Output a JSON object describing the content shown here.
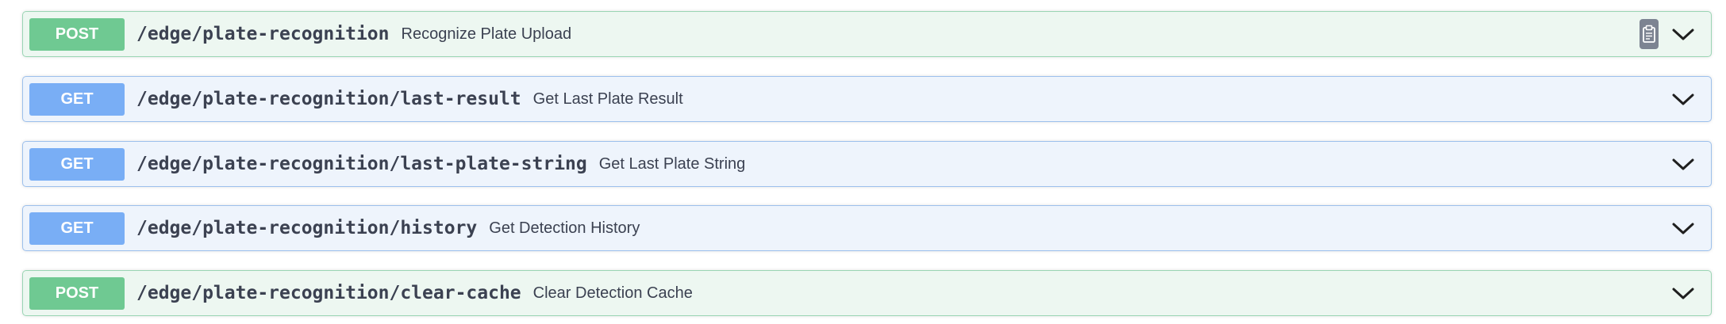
{
  "operations": [
    {
      "method": "POST",
      "path": "/edge/plate-recognition",
      "summary": "Recognize Plate Upload",
      "copy_icon": "clipboard-icon",
      "expand_icon": "chevron-down-icon"
    },
    {
      "method": "GET",
      "path": "/edge/plate-recognition/last-result",
      "summary": "Get Last Plate Result",
      "expand_icon": "chevron-down-icon"
    },
    {
      "method": "GET",
      "path": "/edge/plate-recognition/last-plate-string",
      "summary": "Get Last Plate String",
      "expand_icon": "chevron-down-icon"
    },
    {
      "method": "GET",
      "path": "/edge/plate-recognition/history",
      "summary": "Get Detection History",
      "expand_icon": "chevron-down-icon"
    },
    {
      "method": "POST",
      "path": "/edge/plate-recognition/clear-cache",
      "summary": "Clear Detection Cache",
      "expand_icon": "chevron-down-icon"
    }
  ],
  "colors": {
    "post_badge": "#6fc992",
    "post_background": "#edf7f1",
    "post_border": "#9ad5b4",
    "get_badge": "#79aef5",
    "get_background": "#eef4fc",
    "get_border": "#9cc0ec",
    "text": "#3b4151"
  }
}
